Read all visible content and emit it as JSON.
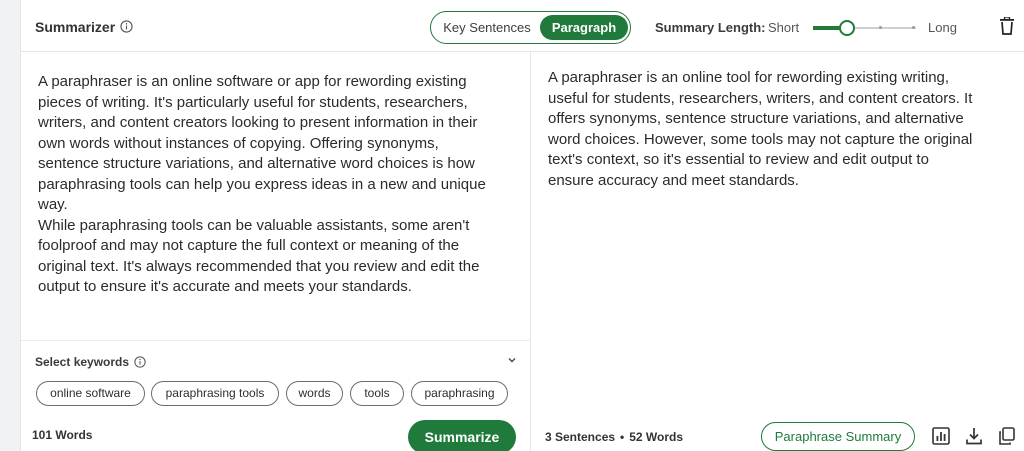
{
  "header": {
    "title": "Summarizer",
    "modes": [
      "Key Sentences",
      "Paragraph"
    ],
    "active_mode": "Paragraph",
    "summary_length": {
      "label": "Summary Length:",
      "min_label": "Short",
      "max_label": "Long",
      "value_fraction": 0.33
    }
  },
  "input": {
    "paragraphs": [
      "A paraphraser is an online software or app for rewording existing pieces of writing. It's particularly useful for students, researchers, writers, and content creators looking to present information in their own words without instances of copying. Offering synonyms, sentence structure variations, and alternative word choices is how paraphrasing tools can help you express ideas in a new and unique way.",
      "While paraphrasing tools can be valuable assistants, some aren't foolproof and may not capture the full context or meaning of the original text. It's always recommended that you review and edit the output to ensure it's accurate and meets your standards."
    ],
    "keywords_label": "Select keywords",
    "keywords": [
      "online software",
      "paraphrasing tools",
      "words",
      "tools",
      "paraphrasing"
    ],
    "word_count": "101 Words",
    "summarize_label": "Summarize"
  },
  "output": {
    "text": "A paraphraser is an online tool for rewording existing writing, useful for students, researchers, writers, and content creators. It offers synonyms, sentence structure variations, and alternative word choices. However, some tools may not capture the original text's context, so it's essential to review and edit output to ensure accuracy and meet standards.",
    "sentences": "3 Sentences",
    "separator": "•",
    "words": "52 Words",
    "paraphrase_summary_label": "Paraphrase Summary"
  },
  "colors": {
    "accent": "#1f7a3c"
  },
  "icons": {
    "title_info": "info-icon",
    "delete": "trash-icon",
    "keywords_info": "info-icon",
    "keywords_toggle": "chevron-down-icon",
    "stats": "bar-chart-icon",
    "download": "download-icon",
    "copy": "copy-icon"
  }
}
